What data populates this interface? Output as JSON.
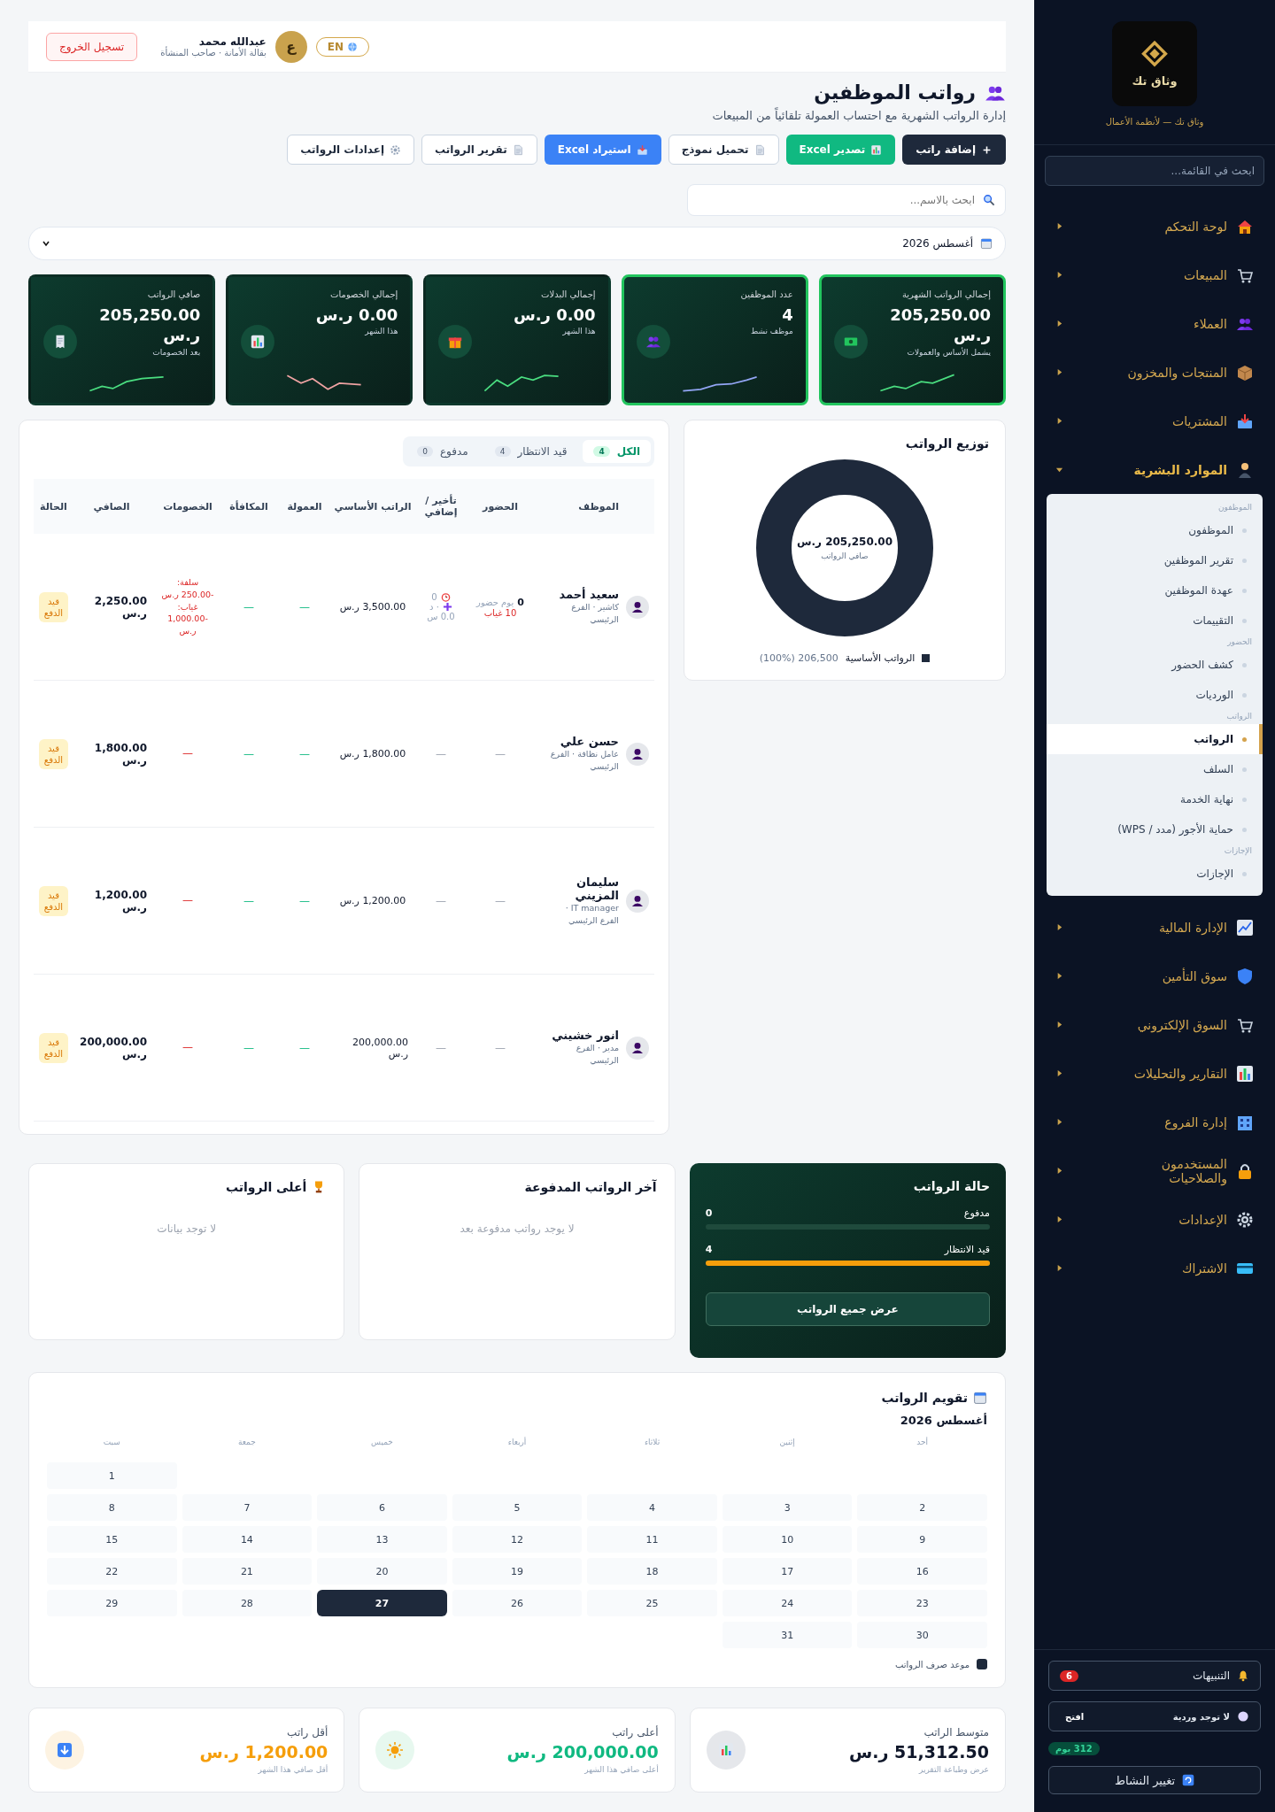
{
  "sidebar": {
    "logo_text": "وثاق تك",
    "tagline": "وثاق تك — لأنظمة الأعمال",
    "search_placeholder": "ابحث في القائمة...",
    "menu_top": [
      {
        "label": "لوحة التحكم",
        "expanded": false
      },
      {
        "label": "المبيعات",
        "expanded": false
      },
      {
        "label": "العملاء",
        "expanded": false
      },
      {
        "label": "المنتجات والمخزون",
        "expanded": false
      },
      {
        "label": "المشتريات",
        "expanded": false
      },
      {
        "label": "الموارد البشرية",
        "expanded": true,
        "children": [
          {
            "heading": "الموظفون",
            "children": [
              {
                "label": "الموظفون",
                "selected": false
              },
              {
                "label": "تقرير الموظفين",
                "selected": false
              },
              {
                "label": "عهدة الموظفين",
                "selected": false
              },
              {
                "label": "التقييمات",
                "selected": false
              }
            ]
          },
          {
            "heading": "الحضور",
            "children": [
              {
                "label": "كشف الحضور",
                "selected": false
              },
              {
                "label": "الورديات",
                "selected": false
              }
            ]
          },
          {
            "heading": "الرواتب",
            "children": [
              {
                "label": "الرواتب",
                "selected": true
              },
              {
                "label": "السلف",
                "selected": false
              },
              {
                "label": "نهاية الخدمة",
                "selected": false
              },
              {
                "label": "حماية الأجور (مدد / WPS)",
                "selected": false
              }
            ]
          },
          {
            "heading": "الإجازات",
            "children": [
              {
                "label": "الإجازات",
                "selected": false
              }
            ]
          }
        ]
      },
      {
        "label": "الإدارة المالية",
        "expanded": false
      },
      {
        "label": "سوق التأمين",
        "expanded": false
      },
      {
        "label": "السوق الإلكتروني",
        "expanded": false
      },
      {
        "label": "التقارير والتحليلات",
        "expanded": false
      },
      {
        "label": "إدارة الفروع",
        "expanded": false
      },
      {
        "label": "المستخدمون والصلاحيات",
        "expanded": false
      },
      {
        "label": "الإعدادات",
        "expanded": false
      },
      {
        "label": "الاشتراك",
        "expanded": false
      }
    ],
    "notifications": {
      "label": "التنبيهات",
      "count": "6"
    },
    "shift": {
      "label": "لا توجد وردية",
      "button": "افتح"
    },
    "days_left": "312 يوم",
    "switch_button": "تغيير النشاط"
  },
  "header": {
    "language": "EN",
    "avatar_letter": "ع",
    "user_name": "عبدالله محمد",
    "user_subtitle": "بقالة الأمانة · صاحب المنشأة",
    "logout": "تسجيل الخروج"
  },
  "page": {
    "title": "رواتب الموظفين",
    "subtitle": "إدارة الرواتب الشهرية مع احتساب العمولة تلقائياً من المبيعات"
  },
  "actions": [
    {
      "label": "إضافة راتب",
      "kind": "dark"
    },
    {
      "label": "تصدير Excel",
      "kind": "green"
    },
    {
      "label": "تحميل نموذج",
      "kind": "light"
    },
    {
      "label": "استيراد Excel",
      "kind": "blue"
    },
    {
      "label": "تقرير الرواتب",
      "kind": "light"
    },
    {
      "label": "إعدادات الرواتب",
      "kind": "light"
    }
  ],
  "search": {
    "placeholder": "ابحث بالاسم..."
  },
  "month": "أغسطس 2026",
  "stats": [
    {
      "label": "إجمالي الرواتب الشهرية",
      "value": "205,250.00 ر.س",
      "note": "يشمل الأساس والعمولات",
      "highlighted": true,
      "color": "#4ade80"
    },
    {
      "label": "عدد الموظفين",
      "value": "4",
      "note": "موظف نشط",
      "highlighted": true,
      "color": "#93a6f5"
    },
    {
      "label": "إجمالي البدلات",
      "value": "0.00 ر.س",
      "note": "هذا الشهر",
      "highlighted": false,
      "color": "#4ade80"
    },
    {
      "label": "إجمالي الخصومات",
      "value": "0.00 ر.س",
      "note": "هذا الشهر",
      "highlighted": false,
      "color": "#f0a3a3"
    },
    {
      "label": "صافي الرواتب",
      "value": "205,250.00 ر.س",
      "note": "بعد الخصومات",
      "highlighted": false,
      "color": "#4ade80"
    }
  ],
  "table": {
    "tabs": [
      {
        "label": "الكل",
        "count": "4",
        "selected": true
      },
      {
        "label": "قيد الانتظار",
        "count": "4",
        "selected": false
      },
      {
        "label": "مدفوع",
        "count": "0",
        "selected": false
      }
    ],
    "columns": [
      "الموظف",
      "الحضور",
      "تأخير / إضافي",
      "الراتب الأساسي",
      "العمولة",
      "المكافأة",
      "الخصومات",
      "الصافي",
      "الحالة"
    ],
    "rows": [
      {
        "name": "سعيد أحمد",
        "role": "كاشير · الفرع الرئيسي",
        "attendance": {
          "kind": "detail",
          "days": "0",
          "days_label": "يوم حضور",
          "absent": "10 غياب"
        },
        "late": {
          "kind": "detail",
          "late": "0",
          "extra": "· د",
          "hours": "0.0 س"
        },
        "basic": "3,500.00 ر.س",
        "commission": "—",
        "bonus": "—",
        "deductions": [
          "سلفة: -250.00 ر.س",
          "غياب: -1,000.00 ر.س"
        ],
        "net": "2,250.00 ر.س",
        "status": {
          "label": "قيد الدفع",
          "kind": "pending"
        }
      },
      {
        "name": "حسن علي",
        "role": "عامل نظافة · الفرع الرئيسي",
        "attendance": {
          "kind": "none",
          "text": "—"
        },
        "late": {
          "kind": "none",
          "text": "—"
        },
        "basic": "1,800.00 ر.س",
        "commission": "—",
        "bonus": "—",
        "deductions": [
          "—"
        ],
        "net": "1,800.00 ر.س",
        "status": {
          "label": "قيد الدفع",
          "kind": "pending"
        }
      },
      {
        "name": "سليمان المزيني",
        "role": "IT manager · الفرع الرئيسي",
        "attendance": {
          "kind": "none",
          "text": "—"
        },
        "late": {
          "kind": "none",
          "text": "—"
        },
        "basic": "1,200.00 ر.س",
        "commission": "—",
        "bonus": "—",
        "deductions": [
          "—"
        ],
        "net": "1,200.00 ر.س",
        "status": {
          "label": "قيد الدفع",
          "kind": "pending"
        }
      },
      {
        "name": "انور خشيني",
        "role": "مدير · الفرع الرئيسي",
        "attendance": {
          "kind": "none",
          "text": "—"
        },
        "late": {
          "kind": "none",
          "text": "—"
        },
        "basic": "200,000.00 ر.س",
        "commission": "—",
        "bonus": "—",
        "deductions": [
          "—"
        ],
        "net": "200,000.00 ر.س",
        "status": {
          "label": "قيد الدفع",
          "kind": "pending"
        }
      }
    ]
  },
  "distribution": {
    "title": "توزيع الرواتب",
    "center_value": "205,250.00 ر.س",
    "center_label": "صافي الرواتب",
    "legend": [
      {
        "label": "الرواتب الأساسية",
        "value": "206,500 (100%)",
        "color": "#1e293b"
      }
    ]
  },
  "status_panel": {
    "title": "حالة الرواتب",
    "bars": [
      {
        "label": "مدفوع",
        "count": "0",
        "level": 0
      },
      {
        "label": "قيد الانتظار",
        "count": "4",
        "level": 1
      }
    ],
    "button": "عرض جميع الرواتب"
  },
  "latest_paid": {
    "title": "آخر الرواتب المدفوعة",
    "empty": "لا يوجد رواتب مدفوعة بعد"
  },
  "top_salaries": {
    "title": "أعلى الرواتب",
    "empty": "لا توجد بيانات"
  },
  "calendar": {
    "title": "تقويم الرواتب",
    "month": "أغسطس 2026",
    "weekdays": [
      "أحد",
      "إثنين",
      "ثلاثاء",
      "أربعاء",
      "خميس",
      "جمعة",
      "سبت"
    ],
    "weeks": [
      [
        {
          "kind": "blank"
        },
        {
          "kind": "blank"
        },
        {
          "kind": "blank"
        },
        {
          "kind": "blank"
        },
        {
          "kind": "blank"
        },
        {
          "kind": "blank"
        },
        {
          "kind": "day",
          "day": "1",
          "selected": false
        }
      ],
      [
        {
          "day": "2",
          "selected": false
        },
        {
          "day": "3",
          "selected": false
        },
        {
          "day": "4",
          "selected": false
        },
        {
          "day": "5",
          "selected": false
        },
        {
          "day": "6",
          "selected": false
        },
        {
          "day": "7",
          "selected": false
        },
        {
          "day": "8",
          "selected": false
        }
      ],
      [
        {
          "day": "9",
          "selected": false
        },
        {
          "day": "10",
          "selected": false
        },
        {
          "day": "11",
          "selected": false
        },
        {
          "day": "12",
          "selected": false
        },
        {
          "day": "13",
          "selected": false
        },
        {
          "day": "14",
          "selected": false
        },
        {
          "day": "15",
          "selected": false
        }
      ],
      [
        {
          "day": "16",
          "selected": false
        },
        {
          "day": "17",
          "selected": false
        },
        {
          "day": "18",
          "selected": false
        },
        {
          "day": "19",
          "selected": false
        },
        {
          "day": "20",
          "selected": false
        },
        {
          "day": "21",
          "selected": false
        },
        {
          "day": "22",
          "selected": false
        }
      ],
      [
        {
          "day": "23",
          "selected": false
        },
        {
          "day": "24",
          "selected": false
        },
        {
          "day": "25",
          "selected": false
        },
        {
          "day": "26",
          "selected": false
        },
        {
          "day": "27",
          "selected": true
        },
        {
          "day": "28",
          "selected": false
        },
        {
          "day": "29",
          "selected": false
        }
      ],
      [
        {
          "day": "30",
          "selected": false
        },
        {
          "day": "31",
          "selected": false
        },
        {
          "kind": "blank"
        },
        {
          "kind": "blank"
        },
        {
          "kind": "blank"
        },
        {
          "kind": "blank"
        },
        {
          "kind": "blank"
        }
      ]
    ],
    "legend": "موعد صرف الرواتب"
  },
  "summary": [
    {
      "label": "متوسط الراتب",
      "value": "51,312.50 ر.س",
      "note": "عرض وطباعة التقرير",
      "kind": "average"
    },
    {
      "label": "أعلى راتب",
      "value": "200,000.00 ر.س",
      "note": "أعلى صافي هذا الشهر",
      "kind": "highest"
    },
    {
      "label": "أقل راتب",
      "value": "1,200.00 ر.س",
      "note": "أقل صافي هذا الشهر",
      "kind": "lowest"
    }
  ]
}
